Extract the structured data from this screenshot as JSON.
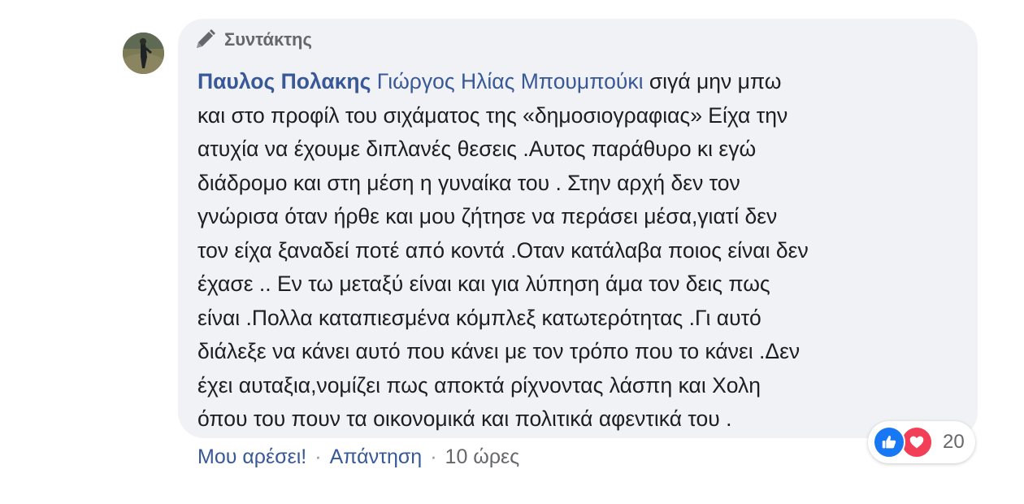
{
  "comment": {
    "badge_label": "Συντάκτης",
    "author": "Παυλος Πολακης",
    "mention": "Γιώργος Ηλίας Μπουμπούκι",
    "lines": [
      " σιγά μην μπω",
      "και στο προφίλ του σιχάματος της «δημοσιογραφιας» Είχα την",
      "ατυχία να έχουμε διπλανές θεσεις .Αυτος παράθυρο κι εγώ",
      "διάδρομο και στη μέση η γυναίκα του . Στην αρχή δεν τον",
      "γνώρισα όταν ήρθε και μου ζήτησε να περάσει μέσα,γιατί δεν",
      "τον είχα ξαναδεί ποτέ από κοντά .Οταν κατάλαβα ποιος είναι δεν",
      "έχασε .. Εν τω μεταξύ είναι και για λύπηση άμα τον δεις πως",
      "είναι .Πολλα καταπιεσμένα κόμπλεξ κατωτερότητας .Γι αυτό",
      "διάλεξε να κάνει αυτό που κάνει με τον τρόπο που το κάνει .Δεν",
      "έχει αυταξια,νομίζει πως αποκτά ρίχνοντας λάσπη και Χολη",
      "όπου του πουν τα οικονομικά και πολιτικά αφεντικά του ."
    ]
  },
  "actions": {
    "like_label": "Μου αρέσει!",
    "reply_label": "Απάντηση",
    "separator": "·",
    "time": "10 ώρες"
  },
  "reactions": {
    "icons": [
      "like-icon",
      "love-icon"
    ],
    "count": "20",
    "like_color": "#1877f2",
    "love_color": "#f33e58"
  },
  "colors": {
    "link": "#385898",
    "bubble": "#f0f2f5",
    "text": "#1c1e21"
  }
}
